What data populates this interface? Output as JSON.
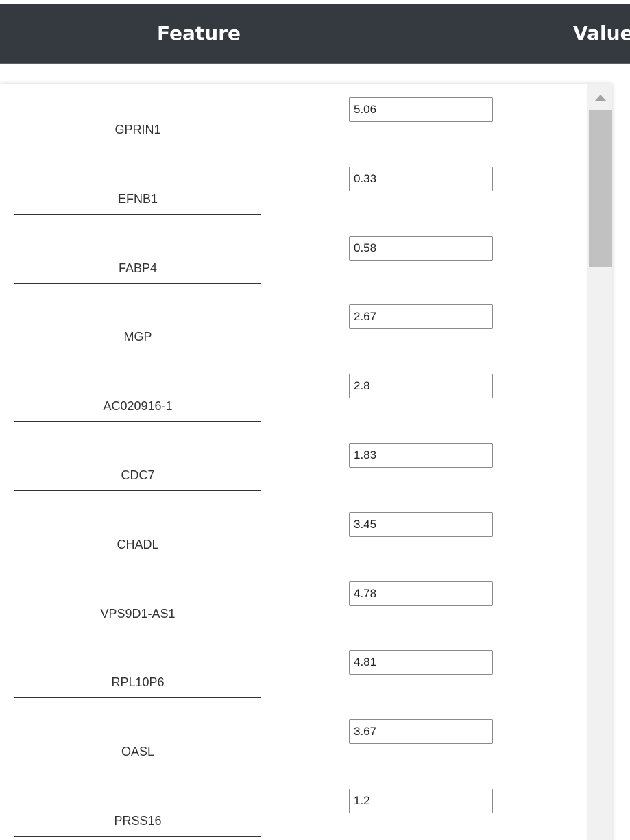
{
  "table": {
    "headers": {
      "feature": "Feature",
      "value": "Value"
    },
    "rows": [
      {
        "feature": "GPRIN1",
        "value": "5.06"
      },
      {
        "feature": "EFNB1",
        "value": "0.33"
      },
      {
        "feature": "FABP4",
        "value": "0.58"
      },
      {
        "feature": "MGP",
        "value": "2.67"
      },
      {
        "feature": "AC020916-1",
        "value": "2.8"
      },
      {
        "feature": "CDC7",
        "value": "1.83"
      },
      {
        "feature": "CHADL",
        "value": "3.45"
      },
      {
        "feature": "VPS9D1-AS1",
        "value": "4.78"
      },
      {
        "feature": "RPL10P6",
        "value": "4.81"
      },
      {
        "feature": "OASL",
        "value": "3.67"
      },
      {
        "feature": "PRSS16",
        "value": "1.2"
      }
    ]
  },
  "colors": {
    "header_bg": "#343a40",
    "header_text": "#ffffff",
    "scrollbar_track": "#f1f1f1",
    "scrollbar_thumb": "#c1c1c1"
  },
  "icons": {
    "scroll_up": "scroll-up-arrow-icon"
  }
}
